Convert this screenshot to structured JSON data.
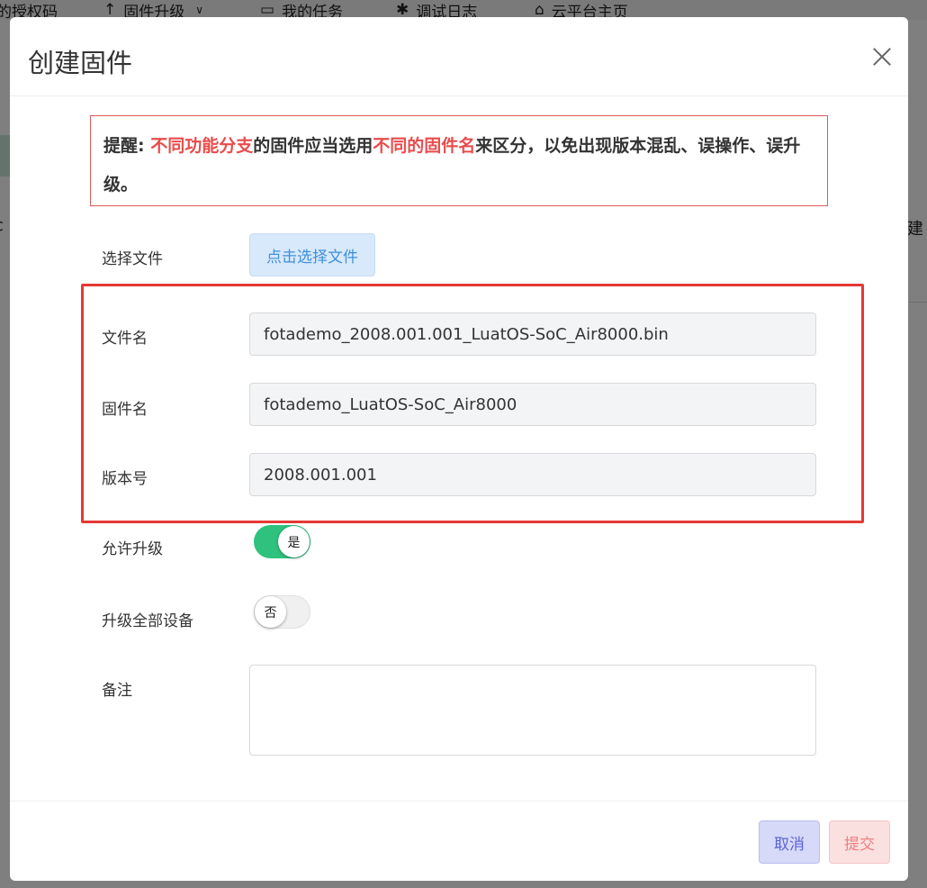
{
  "background": {
    "nav": [
      {
        "icon": "",
        "label": "的授权码"
      },
      {
        "icon": "arrow-up-icon",
        "label": "固件升级",
        "caret": "chevron-down-icon"
      },
      {
        "icon": "calendar-icon",
        "label": "我的任务"
      },
      {
        "icon": "bug-icon",
        "label": "调试日志"
      },
      {
        "icon": "home-icon",
        "label": "云平台主页"
      }
    ],
    "left_fragment": "c",
    "right_fragment": "建"
  },
  "modal": {
    "title": "创建固件",
    "notice": {
      "prefix": "提醒: ",
      "hl1": "不同功能分支",
      "mid": "的固件应当选用",
      "hl2": "不同的固件名",
      "suffix": "来区分，以免出现版本混乱、误操作、误升级。"
    },
    "form": {
      "file_label": "选择文件",
      "file_button": "点击选择文件",
      "filename_label": "文件名",
      "filename_value": "fotademo_2008.001.001_LuatOS-SoC_Air8000.bin",
      "firmware_label": "固件名",
      "firmware_value": "fotademo_LuatOS-SoC_Air8000",
      "version_label": "版本号",
      "version_value": "2008.001.001",
      "allow_label": "允许升级",
      "allow_value": "是",
      "allow_on": true,
      "all_label": "升级全部设备",
      "all_value": "否",
      "all_on": false,
      "remark_label": "备注",
      "remark_value": ""
    },
    "footer": {
      "cancel": "取消",
      "submit": "提交"
    }
  },
  "colors": {
    "accent_green": "#2ec27e",
    "highlight_red": "#e53935",
    "notice_red": "#e84c4c"
  }
}
